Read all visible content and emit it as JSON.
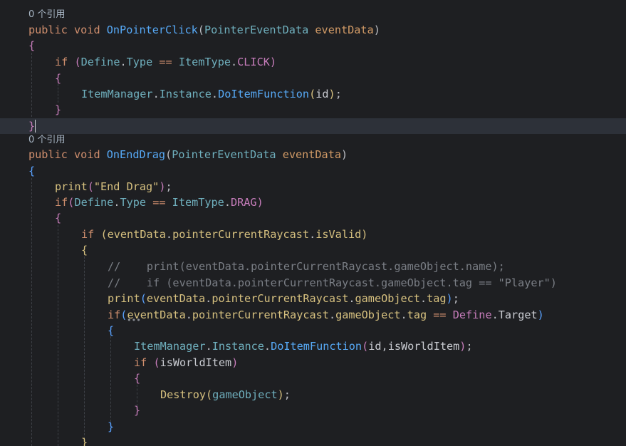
{
  "hint_ref": "0 个引用",
  "kw": {
    "public": "public",
    "void": "void",
    "if": "if"
  },
  "methods": {
    "click": "OnPointerClick",
    "enddrag": "OnEndDrag"
  },
  "types": {
    "ped": "PointerEventData",
    "define": "Define",
    "itemtype": "ItemType",
    "itemmanager": "ItemManager"
  },
  "idents": {
    "eventData": "eventData",
    "type": "Type",
    "click": "CLICK",
    "drag": "DRAG",
    "instance": "Instance",
    "doItemFunction": "DoItemFunction",
    "id": "id",
    "print": "print",
    "pointerCurrentRaycast": "pointerCurrentRaycast",
    "isValid": "isValid",
    "gameObject": "gameObject",
    "tag": "tag",
    "target": "Target",
    "isWorldItem": "isWorldItem",
    "destroy": "Destroy"
  },
  "strings": {
    "end_drag": "\"End Drag\""
  },
  "comments": {
    "c1": "//    print(eventData.pointerCurrentRaycast.gameObject.name);",
    "c2": "//    if (eventData.pointerCurrentRaycast.gameObject.tag == \"Player\")"
  },
  "colors": {
    "background": "#1e1f22",
    "current_line": "#2d3139",
    "keyword": "#cf8e6d",
    "method": "#56a8f5",
    "class": "#6fafbd",
    "string": "#d6c07f",
    "comment": "#7a7e85"
  }
}
